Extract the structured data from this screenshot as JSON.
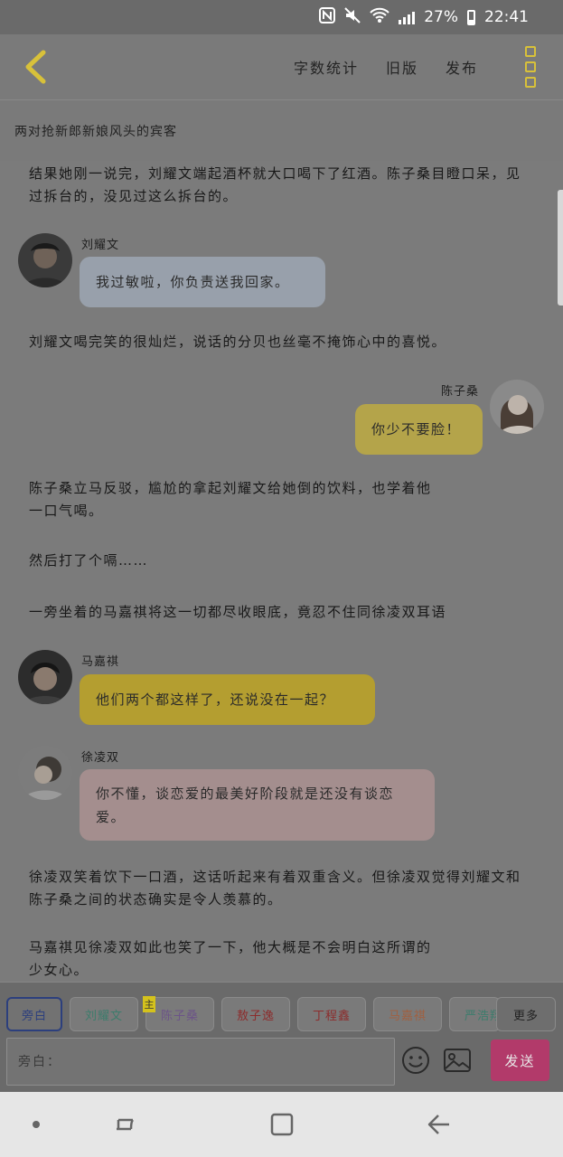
{
  "status_bar": {
    "battery": "27%",
    "time": "22:41",
    "icons": [
      "nfc-icon",
      "mute-icon",
      "wifi-icon",
      "signal-icon",
      "battery-icon"
    ]
  },
  "toolbar": {
    "word_count": "字数统计",
    "old_version": "旧版",
    "publish": "发布"
  },
  "story_title": "两对抢新郎新娘风头的宾客",
  "content": {
    "narration_1": "结果她刚一说完，刘耀文端起酒杯就大口喝下了红酒。陈子桑目瞪口呆，见过拆台的，没见过这么拆台的。",
    "msg_1": {
      "speaker": "刘耀文",
      "text": "我过敏啦，你负责送我回家。",
      "color": "#98a0ab"
    },
    "narration_2": "刘耀文喝完笑的很灿烂，说话的分贝也丝毫不掩饰心中的喜悦。",
    "msg_2": {
      "speaker": "陈子桑",
      "text": "你少不要脸！",
      "color": "#b4a44a"
    },
    "narration_3": "陈子桑立马反驳，尴尬的拿起刘耀文给她倒的饮料，也学着他一口气喝。",
    "narration_4": "然后打了个嗝……",
    "narration_5": "一旁坐着的马嘉祺将这一切都尽收眼底，竟忍不住同徐凌双耳语",
    "msg_3": {
      "speaker": "马嘉祺",
      "text": "他们两个都这样了，还说没在一起？",
      "color": "#b49e30"
    },
    "msg_4": {
      "speaker": "徐凌双",
      "text": "你不懂，谈恋爱的最美好阶段就是还没有谈恋爱。",
      "color": "#a48e8e"
    },
    "narration_6": "徐凌双笑着饮下一口酒，这话听起来有着双重含义。但徐凌双觉得刘耀文和陈子桑之间的状态确实是令人羡慕的。",
    "narration_7": "马嘉祺见徐凌双如此也笑了一下，他大概是不会明白这所谓的少女心。"
  },
  "characters": [
    {
      "label": "旁白",
      "color": "#2c3f7d"
    },
    {
      "label": "刘耀文",
      "color": "#3c7c6c"
    },
    {
      "label": "陈子桑",
      "color": "#6c5488"
    },
    {
      "label": "敖子逸",
      "color": "#8c2c2c"
    },
    {
      "label": "丁程鑫",
      "color": "#8c2c2c"
    },
    {
      "label": "马嘉祺",
      "color": "#a06040"
    },
    {
      "label": "严浩翔",
      "color": "#3c7c6c"
    }
  ],
  "main_badge": "主",
  "more_label": "更多",
  "input": {
    "placeholder": "旁白："
  },
  "send_label": "发送"
}
